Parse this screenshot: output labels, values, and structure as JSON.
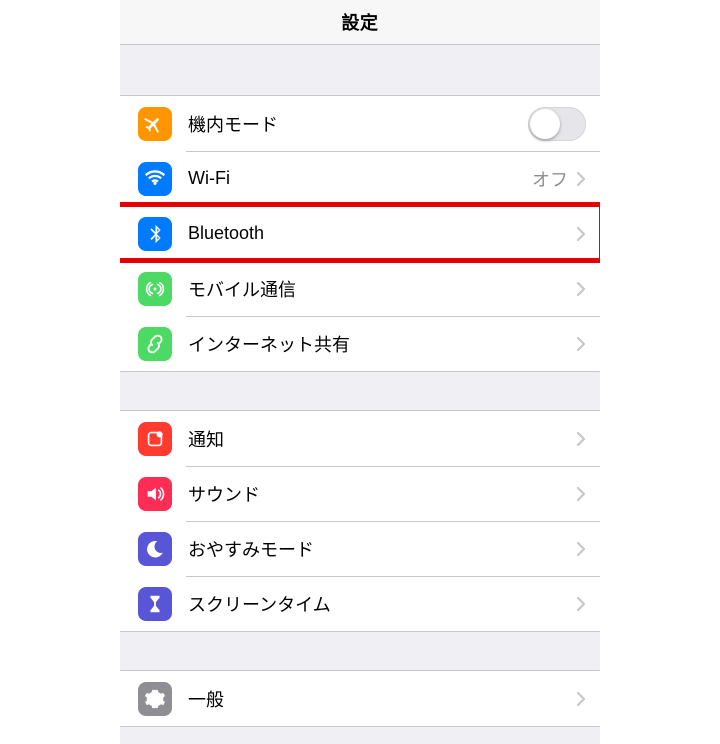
{
  "header": {
    "title": "設定"
  },
  "colors": {
    "orange": "#ff9500",
    "blue": "#007aff",
    "green": "#4cd964",
    "red": "#ff3b30",
    "pink": "#ff2d55",
    "purple": "#5856d6",
    "gray": "#8e8e93"
  },
  "groups": [
    {
      "rows": [
        {
          "id": "airplane-mode",
          "label": "機内モード",
          "icon": "airplane-icon",
          "icon_color": "orange",
          "control": "toggle",
          "toggle_on": false
        },
        {
          "id": "wifi",
          "label": "Wi-Fi",
          "icon": "wifi-icon",
          "icon_color": "blue",
          "control": "disclosure",
          "value": "オフ"
        },
        {
          "id": "bluetooth",
          "label": "Bluetooth",
          "icon": "bluetooth-icon",
          "icon_color": "blue",
          "control": "disclosure",
          "highlighted": true
        },
        {
          "id": "cellular",
          "label": "モバイル通信",
          "icon": "antenna-icon",
          "icon_color": "green",
          "control": "disclosure"
        },
        {
          "id": "hotspot",
          "label": "インターネット共有",
          "icon": "link-icon",
          "icon_color": "green",
          "control": "disclosure"
        }
      ]
    },
    {
      "rows": [
        {
          "id": "notifications",
          "label": "通知",
          "icon": "notification-icon",
          "icon_color": "red",
          "control": "disclosure"
        },
        {
          "id": "sounds",
          "label": "サウンド",
          "icon": "speaker-icon",
          "icon_color": "pink",
          "control": "disclosure"
        },
        {
          "id": "do-not-disturb",
          "label": "おやすみモード",
          "icon": "moon-icon",
          "icon_color": "purple",
          "control": "disclosure"
        },
        {
          "id": "screen-time",
          "label": "スクリーンタイム",
          "icon": "hourglass-icon",
          "icon_color": "purple",
          "control": "disclosure"
        }
      ]
    },
    {
      "rows": [
        {
          "id": "general",
          "label": "一般",
          "icon": "gear-icon",
          "icon_color": "gray",
          "control": "disclosure"
        }
      ]
    }
  ]
}
